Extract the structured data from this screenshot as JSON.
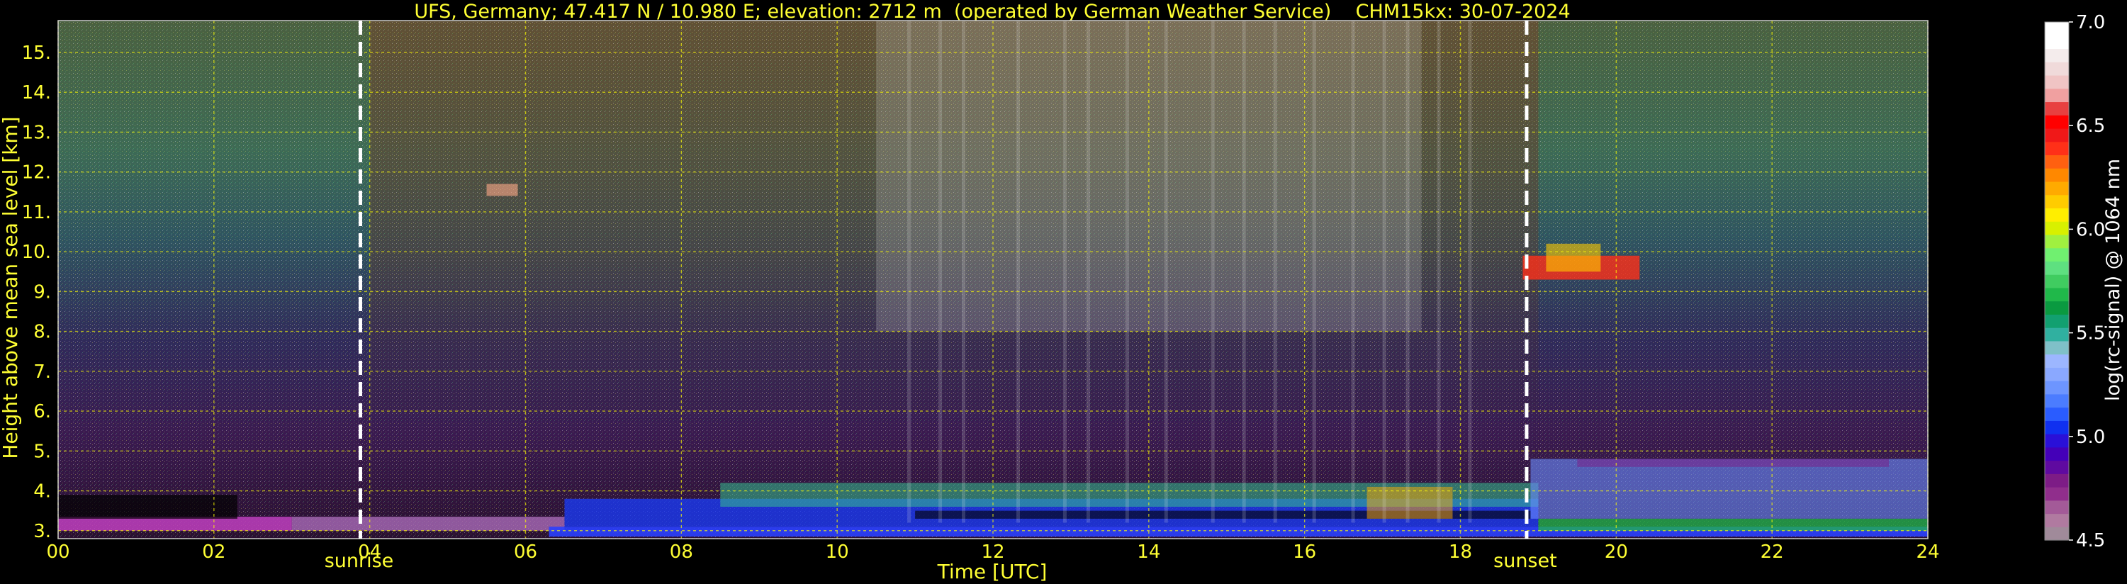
{
  "chart_data": {
    "type": "heatmap",
    "title": "UFS, Germany; 47.417 N / 10.980 E; elevation: 2712 m  (operated by German Weather Service)    CHM15kx: 30-07-2024",
    "xlabel": "Time [UTC]",
    "ylabel": "Height above mean sea level [km]",
    "xlim": [
      0,
      24
    ],
    "ylim": [
      2.8,
      15.8
    ],
    "x_ticks": [
      "00",
      "02",
      "04",
      "06",
      "08",
      "10",
      "12",
      "14",
      "16",
      "18",
      "20",
      "22",
      "24"
    ],
    "x_tick_values": [
      0,
      2,
      4,
      6,
      8,
      10,
      12,
      14,
      16,
      18,
      20,
      22,
      24
    ],
    "y_ticks": [
      "3.",
      "4.",
      "5.",
      "6.",
      "7.",
      "8.",
      "9.",
      "10.",
      "11.",
      "12.",
      "13.",
      "14.",
      "15."
    ],
    "y_tick_values": [
      3,
      4,
      5,
      6,
      7,
      8,
      9,
      10,
      11,
      12,
      13,
      14,
      15
    ],
    "grid": true,
    "colorbar": {
      "label": "log(rc-signal) @ 1064 nm",
      "range": [
        4.5,
        7.0
      ],
      "ticks": [
        "4.5",
        "5.0",
        "5.5",
        "6.0",
        "6.5",
        "7.0"
      ],
      "tick_values": [
        4.5,
        5.0,
        5.5,
        6.0,
        6.5,
        7.0
      ],
      "colors": [
        "#a08a9a",
        "#b07aa0",
        "#a35a98",
        "#902e8c",
        "#7d1c86",
        "#5f0aa0",
        "#4400b8",
        "#2a10d8",
        "#1030f0",
        "#2a5cff",
        "#4b7cff",
        "#6d95ff",
        "#8aa8ff",
        "#9cb6ff",
        "#7fc0c8",
        "#30b0a0",
        "#12a070",
        "#0a9a40",
        "#20b84a",
        "#40cc60",
        "#5ee080",
        "#70f070",
        "#a0f040",
        "#d8f000",
        "#ffee00",
        "#ffcc00",
        "#ffaa00",
        "#ff8800",
        "#ff6010",
        "#ff3018",
        "#f01818",
        "#ff0000",
        "#e84040",
        "#f0a0a0",
        "#f0c4c4",
        "#f0dada",
        "#f4ecec",
        "#ffffff",
        "#ffffff"
      ]
    },
    "vertical_markers": [
      {
        "label": "sunrise",
        "x": 3.88
      },
      {
        "label": "sunset",
        "x": 18.85
      }
    ]
  }
}
